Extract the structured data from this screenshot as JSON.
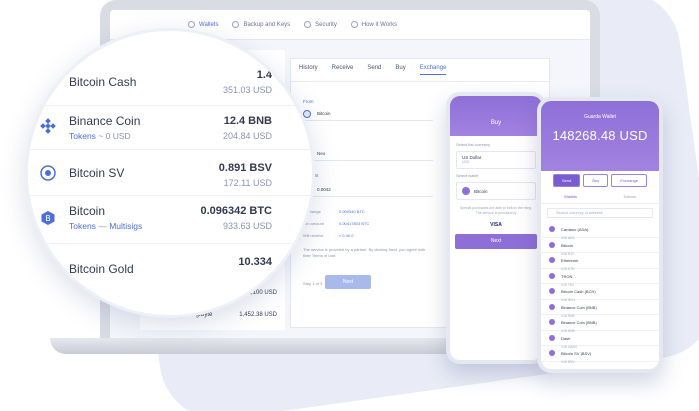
{
  "laptop": {
    "topnav": [
      "Wallets",
      "Backup and Keys",
      "Security",
      "How it Works"
    ],
    "bg_wallets": [
      {
        "usd": "2,100 USD"
      },
      {
        "amount": "1,452.38 USD"
      },
      {
        "name": "DigiByte"
      }
    ],
    "exchange_tabs": [
      "History",
      "Receive",
      "Send",
      "Buy",
      "Exchange"
    ],
    "exchange": {
      "from_label": "From",
      "from_coin": "Bitcoin",
      "to_label": "To",
      "to_coin": "Neo",
      "amount_label": "Amount",
      "amount_value": "0.0042",
      "info": [
        {
          "label": "Exchange",
          "value": "0.000340 BTC"
        },
        {
          "label": "Min amount",
          "value": "0.00417803 BTC"
        },
        {
          "label": "Will receive",
          "value": "≈ 0.40 0"
        }
      ],
      "terms_text": "The service is provided by a partner. By clicking Next, you agree with their Terms of Use.",
      "step": "Step 1 of 3",
      "next_label": "Next"
    }
  },
  "magnifier": {
    "rows": [
      {
        "name": "Bitcoin Cash",
        "amount": "1.4",
        "usd": "351.03 USD",
        "icon": "bitcoin-cash-icon"
      },
      {
        "name": "Binance Coin",
        "tags": [
          "Tokens",
          "~ 0 USD"
        ],
        "amount": "12.4 BNB",
        "usd": "204.84 USD",
        "icon": "binance-icon"
      },
      {
        "name": "Bitcoin SV",
        "amount": "0.891 BSV",
        "usd": "172.11 USD",
        "icon": "bitcoin-sv-icon"
      },
      {
        "name": "Bitcoin",
        "tags": [
          "Tokens",
          "—",
          "Multisigs"
        ],
        "amount": "0.096342 BTC",
        "usd": "933.63 USD",
        "icon": "bitcoin-icon"
      },
      {
        "name": "Bitcoin Gold",
        "amount": "10.334",
        "icon": "bitcoin-gold-icon"
      }
    ]
  },
  "phone1": {
    "title": "Buy",
    "fiat_label": "Select fiat currency",
    "fiat_value": "US Dollar",
    "fiat_sub": "USD",
    "wallet_label": "Select wallet",
    "wallet_coin": "Bitcoin",
    "note": "Special purchases are able to bellow the ming. The service is provided by",
    "payment": "VISA",
    "next_label": "Next"
  },
  "phone2": {
    "title": "Guarda Wallet",
    "balance": "148268.48 USD",
    "buttons": [
      "Send",
      "Buy",
      "Exchange"
    ],
    "tabs": [
      "Wallets",
      "Tokens"
    ],
    "search_placeholder": "Search currency or address",
    "coins": [
      {
        "name": "Cardano (ADA)",
        "sub": "0.00 ADA"
      },
      {
        "name": "Bitcoin",
        "sub": "0.00 BTC"
      },
      {
        "name": "Ethereum",
        "sub": "0.00 ETH"
      },
      {
        "name": "TRON",
        "sub": "0.00 TRX"
      },
      {
        "name": "Bitcoin Cash (BCH)",
        "sub": "0.00 BCH"
      },
      {
        "name": "Binance Coin (BNB)",
        "sub": "0.00 BNB"
      },
      {
        "name": "Binance Coin (BNB)",
        "sub": "0.00 BNB"
      },
      {
        "name": "Dash",
        "sub": "0.00 DASH"
      },
      {
        "name": "Bitcoin SV (BSV)",
        "sub": "0.00 BSV"
      }
    ]
  }
}
